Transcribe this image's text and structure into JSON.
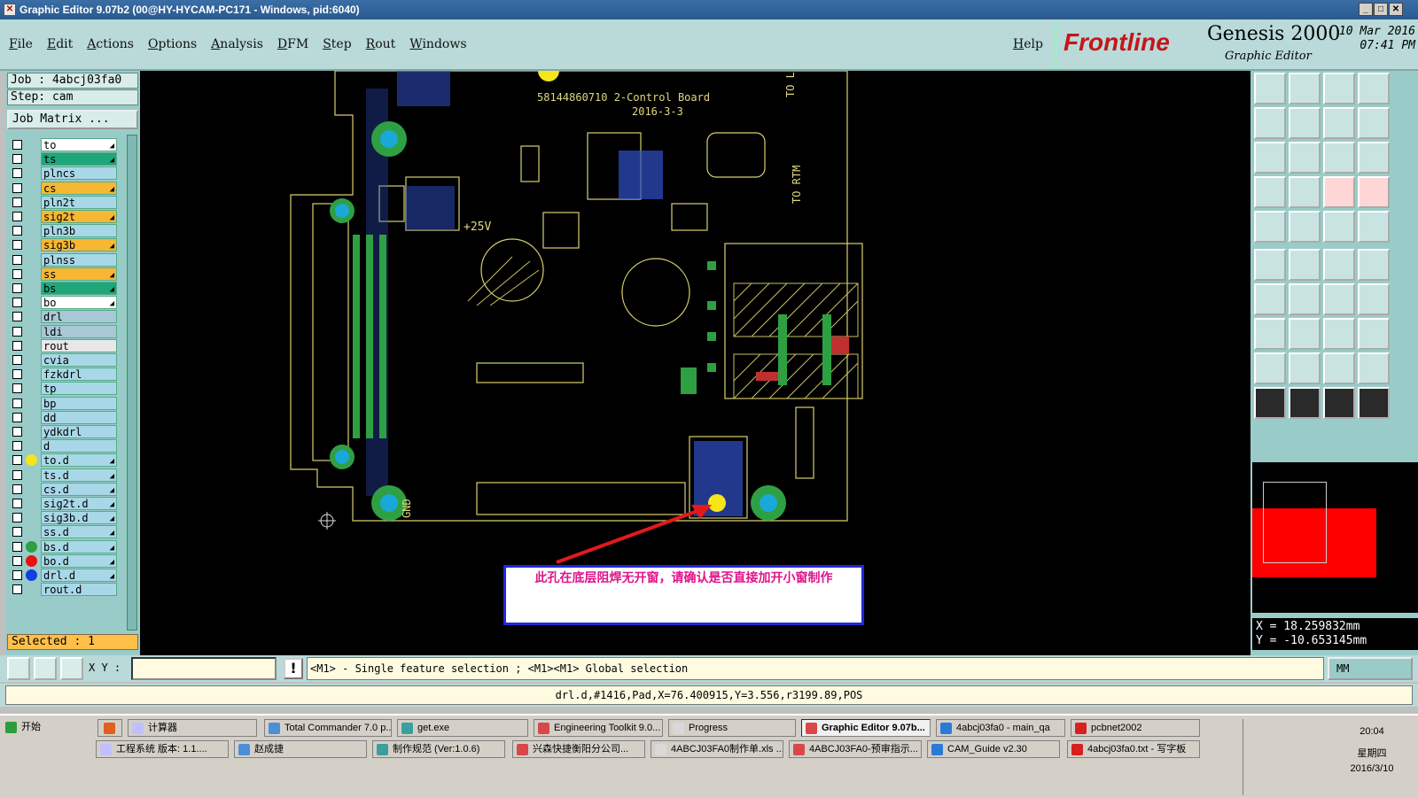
{
  "window": {
    "title": "Graphic Editor 9.07b2 (00@HY-HYCAM-PC171 - Windows, pid:6040)"
  },
  "menu": {
    "items": [
      "File",
      "Edit",
      "Actions",
      "Options",
      "Analysis",
      "DFM",
      "Step",
      "Rout",
      "Windows"
    ],
    "help": "Help"
  },
  "brand": {
    "logo": "Frontline",
    "product": "Genesis 2000",
    "module": "Graphic Editor",
    "date": "10 Mar 2016",
    "time": "07:41 PM"
  },
  "job": {
    "job_line": "Job : 4abcj03fa0",
    "step_line": "Step: cam",
    "matrix_button": "Job Matrix ..."
  },
  "layers": [
    {
      "name": "to",
      "color": "#ffffff",
      "arrow": true
    },
    {
      "name": "ts",
      "color": "#1fa67a",
      "arrow": true
    },
    {
      "name": "plncs",
      "color": "#a8d8e8",
      "arrow": false
    },
    {
      "name": "cs",
      "color": "#f7b733",
      "arrow": true
    },
    {
      "name": "pln2t",
      "color": "#a8d8e8",
      "arrow": false
    },
    {
      "name": "sig2t",
      "color": "#f7b733",
      "arrow": true
    },
    {
      "name": "pln3b",
      "color": "#a8d8e8",
      "arrow": false
    },
    {
      "name": "sig3b",
      "color": "#f7b733",
      "arrow": true
    },
    {
      "name": "plnss",
      "color": "#a8d8e8",
      "arrow": false
    },
    {
      "name": "ss",
      "color": "#f7b733",
      "arrow": true
    },
    {
      "name": "bs",
      "color": "#1fa67a",
      "arrow": true
    },
    {
      "name": "bo",
      "color": "#ffffff",
      "arrow": true
    },
    {
      "name": "drl",
      "color": "#a8c8d8",
      "arrow": false
    },
    {
      "name": "ldi",
      "color": "#a8c8d8",
      "arrow": false
    },
    {
      "name": "rout",
      "color": "#e8e8e8",
      "arrow": false
    },
    {
      "name": "cvia",
      "color": "#a8d8e8",
      "arrow": false
    },
    {
      "name": "fzkdrl",
      "color": "#a8d8e8",
      "arrow": false
    },
    {
      "name": "tp",
      "color": "#a8d8e8",
      "arrow": false
    },
    {
      "name": "bp",
      "color": "#a8d8e8",
      "arrow": false
    },
    {
      "name": "dd",
      "color": "#a8d8e8",
      "arrow": false
    },
    {
      "name": "ydkdrl",
      "color": "#a8d8e8",
      "arrow": false
    },
    {
      "name": "d",
      "color": "#a8d8e8",
      "arrow": false
    },
    {
      "name": "to.d",
      "color": "#a8d8e8",
      "arrow": true,
      "marker": "#f5e51b"
    },
    {
      "name": "ts.d",
      "color": "#a8d8e8",
      "arrow": true
    },
    {
      "name": "cs.d",
      "color": "#a8d8e8",
      "arrow": true
    },
    {
      "name": "sig2t.d",
      "color": "#a8d8e8",
      "arrow": true
    },
    {
      "name": "sig3b.d",
      "color": "#a8d8e8",
      "arrow": true
    },
    {
      "name": "ss.d",
      "color": "#a8d8e8",
      "arrow": true
    },
    {
      "name": "bs.d",
      "color": "#a8d8e8",
      "arrow": true,
      "marker": "#2ea043"
    },
    {
      "name": "bo.d",
      "color": "#a8d8e8",
      "arrow": true,
      "marker": "#e81010"
    },
    {
      "name": "drl.d",
      "color": "#a8d8e8",
      "arrow": true,
      "marker": "#1040e0"
    },
    {
      "name": "rout.d",
      "color": "#a8d8e8",
      "arrow": false
    }
  ],
  "selected_text": "Selected : 1",
  "pcb": {
    "title1": "58144860710 2-Control Board",
    "title2": "2016-3-3",
    "label_25v": "+25V",
    "label_gnd": "GND",
    "label_rtm": "TO RTM",
    "label_le": "TO LE"
  },
  "annotation": {
    "text": "此孔在底层阻焊无开窗，请确认是否直接加开小窗制作"
  },
  "coords": {
    "x": "X = 18.259832mm",
    "y": "Y = -10.653145mm"
  },
  "command": {
    "xy_label": "X Y :",
    "input_value": "",
    "hint": "<M1> - Single feature selection ; <M1><M1> Global selection",
    "units": "MM"
  },
  "feature_info": "drl.d,#1416,Pad,X=76.400915,Y=3.556,r3199.89,POS",
  "taskbar": {
    "start": "开始",
    "row1": [
      "计算器",
      "Total Commander 7.0 p...",
      "get.exe",
      "Engineering Toolkit 9.0...",
      "Progress",
      "Graphic Editor 9.07b...",
      "4abcj03fa0 - main_qa",
      "pcbnet2002"
    ],
    "row2": [
      "工程系统  版本: 1.1....",
      "赵成捷",
      "制作规范 (Ver:1.0.6)",
      "兴森快捷衡阳分公司...",
      "4ABCJ03FA0制作单.xls ...",
      "4ABCJ03FA0-预审指示...",
      "CAM_Guide v2.30",
      "4abcj03fa0.txt - 写字板"
    ],
    "clock": "20:04",
    "weekday": "星期四",
    "date": "2016/3/10"
  },
  "icons": [
    "app-icon",
    "minimize-icon",
    "maximize-icon",
    "close-icon",
    "calculator-icon",
    "folder-icon",
    "gear-icon",
    "arrow-cursor-icon"
  ]
}
